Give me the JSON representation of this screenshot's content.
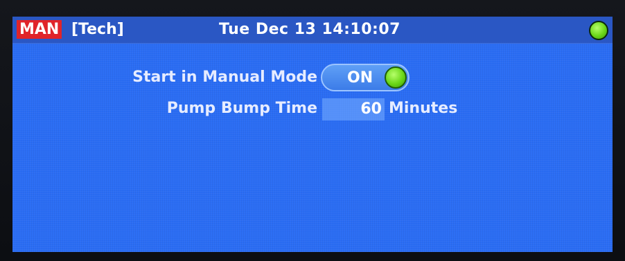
{
  "header": {
    "mode": "MAN",
    "user_level": "[Tech]",
    "datetime": "Tue Dec 13 14:10:07",
    "status_indicator": "green-led"
  },
  "settings": [
    {
      "label": "Start in Manual Mode",
      "control": "toggle",
      "value": "ON"
    },
    {
      "label": "Pump Bump Time",
      "control": "numeric",
      "value": "60",
      "unit": "Minutes"
    }
  ],
  "colors": {
    "screen_bg": "#2a6df4",
    "header_bg": "#2a57c4",
    "mode_badge": "#e0242a",
    "led_on": "#6ad618"
  }
}
